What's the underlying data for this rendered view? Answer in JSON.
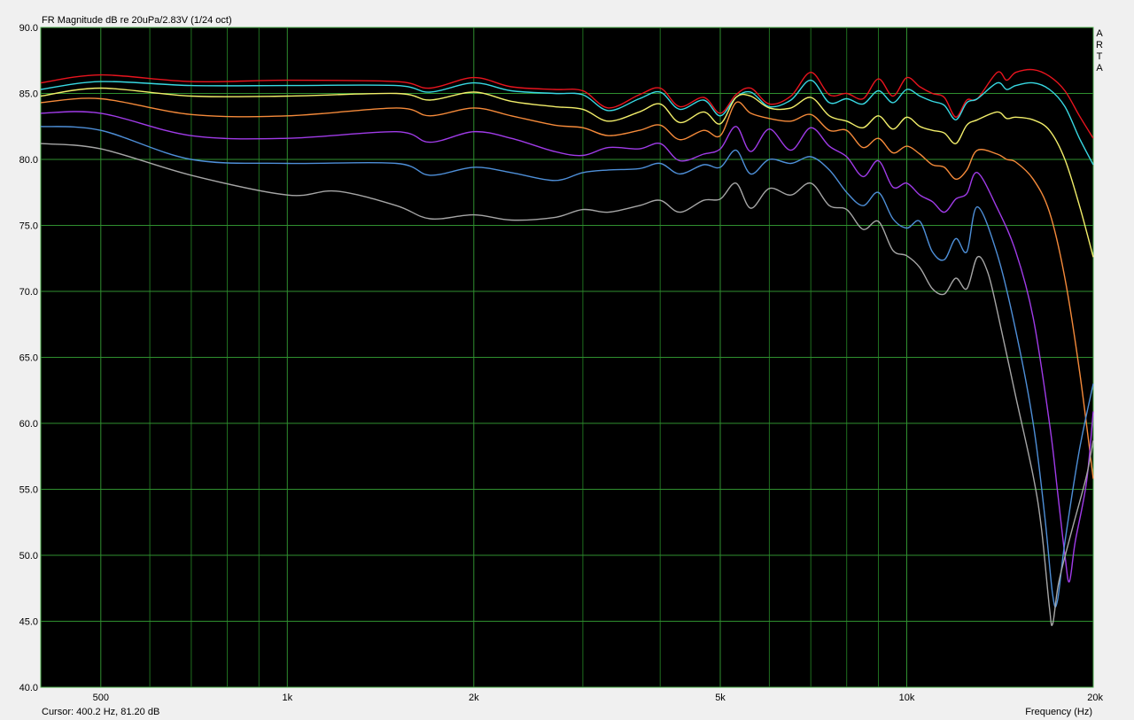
{
  "chart_data": {
    "type": "line",
    "title": "FR Magnitude dB re 20uPa/2.83V (1/24 oct)",
    "xlabel": "Frequency (Hz)",
    "ylabel": "",
    "xscale": "log",
    "xlim": [
      400,
      20000
    ],
    "ylim": [
      40,
      90
    ],
    "grid": true,
    "y_ticks": [
      "90.0",
      "85.0",
      "80.0",
      "75.0",
      "70.0",
      "65.0",
      "60.0",
      "55.0",
      "50.0",
      "45.0",
      "40.0"
    ],
    "x_ticks": [
      {
        "value": 500,
        "label": "500"
      },
      {
        "value": 1000,
        "label": "1k"
      },
      {
        "value": 2000,
        "label": "2k"
      },
      {
        "value": 5000,
        "label": "5k"
      },
      {
        "value": 10000,
        "label": "10k"
      },
      {
        "value": 20000,
        "label": "20k"
      }
    ],
    "cursor_text": "Cursor: 400.2 Hz, 81.20 dB",
    "watermark": "ARTA",
    "series": [
      {
        "color": "#e8141e",
        "points": [
          [
            400,
            85.8
          ],
          [
            500,
            86.4
          ],
          [
            700,
            85.9
          ],
          [
            1000,
            86.0
          ],
          [
            1500,
            85.9
          ],
          [
            1700,
            85.4
          ],
          [
            2000,
            86.2
          ],
          [
            2300,
            85.5
          ],
          [
            2700,
            85.3
          ],
          [
            3000,
            85.2
          ],
          [
            3300,
            83.9
          ],
          [
            3700,
            84.9
          ],
          [
            4000,
            85.4
          ],
          [
            4300,
            84.0
          ],
          [
            4700,
            84.7
          ],
          [
            5000,
            83.5
          ],
          [
            5300,
            84.9
          ],
          [
            5600,
            85.4
          ],
          [
            6000,
            84.2
          ],
          [
            6500,
            84.8
          ],
          [
            7000,
            86.6
          ],
          [
            7500,
            84.9
          ],
          [
            8000,
            85.0
          ],
          [
            8500,
            84.6
          ],
          [
            9000,
            86.1
          ],
          [
            9500,
            84.8
          ],
          [
            10000,
            86.2
          ],
          [
            10500,
            85.5
          ],
          [
            11000,
            85.0
          ],
          [
            11500,
            84.7
          ],
          [
            12000,
            83.2
          ],
          [
            12500,
            84.5
          ],
          [
            13000,
            84.6
          ],
          [
            14000,
            86.6
          ],
          [
            14500,
            86.0
          ],
          [
            15000,
            86.6
          ],
          [
            16000,
            86.8
          ],
          [
            17000,
            86.3
          ],
          [
            18000,
            85.2
          ],
          [
            19000,
            83.3
          ],
          [
            20000,
            81.6
          ]
        ]
      },
      {
        "color": "#38d8e2",
        "points": [
          [
            400,
            85.3
          ],
          [
            500,
            85.9
          ],
          [
            700,
            85.6
          ],
          [
            1000,
            85.6
          ],
          [
            1500,
            85.6
          ],
          [
            1700,
            85.1
          ],
          [
            2000,
            85.8
          ],
          [
            2300,
            85.2
          ],
          [
            2700,
            85.0
          ],
          [
            3000,
            84.9
          ],
          [
            3300,
            83.7
          ],
          [
            3700,
            84.6
          ],
          [
            4000,
            85.1
          ],
          [
            4300,
            83.8
          ],
          [
            4700,
            84.5
          ],
          [
            5000,
            83.3
          ],
          [
            5300,
            84.7
          ],
          [
            5600,
            85.1
          ],
          [
            6000,
            84.0
          ],
          [
            6500,
            84.5
          ],
          [
            7000,
            86.0
          ],
          [
            7500,
            84.3
          ],
          [
            8000,
            84.6
          ],
          [
            8500,
            84.2
          ],
          [
            9000,
            85.2
          ],
          [
            9500,
            84.3
          ],
          [
            10000,
            85.3
          ],
          [
            10500,
            84.8
          ],
          [
            11000,
            84.4
          ],
          [
            11500,
            84.1
          ],
          [
            12000,
            83.0
          ],
          [
            12500,
            84.3
          ],
          [
            13000,
            84.6
          ],
          [
            14000,
            85.8
          ],
          [
            14500,
            85.3
          ],
          [
            15000,
            85.6
          ],
          [
            16000,
            85.8
          ],
          [
            17000,
            85.3
          ],
          [
            18000,
            84.0
          ],
          [
            19000,
            81.6
          ],
          [
            20000,
            79.6
          ]
        ]
      },
      {
        "color": "#f2ee6a",
        "points": [
          [
            400,
            84.8
          ],
          [
            500,
            85.4
          ],
          [
            700,
            84.8
          ],
          [
            1000,
            84.8
          ],
          [
            1500,
            85.0
          ],
          [
            1700,
            84.5
          ],
          [
            2000,
            85.1
          ],
          [
            2300,
            84.4
          ],
          [
            2700,
            84.0
          ],
          [
            3000,
            83.8
          ],
          [
            3300,
            82.9
          ],
          [
            3700,
            83.6
          ],
          [
            4000,
            84.2
          ],
          [
            4300,
            82.8
          ],
          [
            4700,
            83.6
          ],
          [
            5000,
            82.7
          ],
          [
            5300,
            84.7
          ],
          [
            5600,
            84.8
          ],
          [
            6000,
            83.9
          ],
          [
            6500,
            83.9
          ],
          [
            7000,
            84.7
          ],
          [
            7500,
            83.3
          ],
          [
            8000,
            82.9
          ],
          [
            8500,
            82.4
          ],
          [
            9000,
            83.3
          ],
          [
            9500,
            82.3
          ],
          [
            10000,
            83.2
          ],
          [
            10500,
            82.5
          ],
          [
            11000,
            82.2
          ],
          [
            11500,
            82.0
          ],
          [
            12000,
            81.2
          ],
          [
            12500,
            82.6
          ],
          [
            13000,
            83.0
          ],
          [
            14000,
            83.6
          ],
          [
            14500,
            83.1
          ],
          [
            15000,
            83.2
          ],
          [
            16000,
            83.0
          ],
          [
            17000,
            82.2
          ],
          [
            18000,
            80.0
          ],
          [
            19000,
            76.5
          ],
          [
            20000,
            72.6
          ]
        ]
      },
      {
        "color": "#f58a3a",
        "points": [
          [
            400,
            84.3
          ],
          [
            500,
            84.6
          ],
          [
            700,
            83.4
          ],
          [
            1000,
            83.3
          ],
          [
            1500,
            83.9
          ],
          [
            1700,
            83.3
          ],
          [
            2000,
            83.9
          ],
          [
            2300,
            83.3
          ],
          [
            2700,
            82.6
          ],
          [
            3000,
            82.4
          ],
          [
            3300,
            81.8
          ],
          [
            3700,
            82.2
          ],
          [
            4000,
            82.6
          ],
          [
            4300,
            81.5
          ],
          [
            4700,
            82.2
          ],
          [
            5000,
            81.8
          ],
          [
            5300,
            84.3
          ],
          [
            5600,
            83.5
          ],
          [
            6000,
            83.1
          ],
          [
            6500,
            82.9
          ],
          [
            7000,
            83.4
          ],
          [
            7500,
            82.2
          ],
          [
            8000,
            82.2
          ],
          [
            8500,
            80.9
          ],
          [
            9000,
            81.6
          ],
          [
            9500,
            80.5
          ],
          [
            10000,
            81.0
          ],
          [
            10500,
            80.4
          ],
          [
            11000,
            79.6
          ],
          [
            11500,
            79.4
          ],
          [
            12000,
            78.5
          ],
          [
            12500,
            79.2
          ],
          [
            13000,
            80.7
          ],
          [
            14000,
            80.4
          ],
          [
            14500,
            80.0
          ],
          [
            15000,
            79.8
          ],
          [
            16000,
            78.5
          ],
          [
            17000,
            76.0
          ],
          [
            18000,
            71.0
          ],
          [
            19000,
            64.0
          ],
          [
            20000,
            55.8
          ]
        ]
      },
      {
        "color": "#a03be8",
        "points": [
          [
            400,
            83.5
          ],
          [
            500,
            83.5
          ],
          [
            700,
            81.8
          ],
          [
            1000,
            81.6
          ],
          [
            1500,
            82.1
          ],
          [
            1700,
            81.3
          ],
          [
            2000,
            82.1
          ],
          [
            2300,
            81.6
          ],
          [
            2700,
            80.6
          ],
          [
            3000,
            80.3
          ],
          [
            3300,
            80.9
          ],
          [
            3700,
            80.8
          ],
          [
            4000,
            81.2
          ],
          [
            4300,
            79.9
          ],
          [
            4700,
            80.4
          ],
          [
            5000,
            80.8
          ],
          [
            5300,
            82.5
          ],
          [
            5600,
            80.6
          ],
          [
            6000,
            82.3
          ],
          [
            6500,
            80.7
          ],
          [
            7000,
            82.4
          ],
          [
            7500,
            81.0
          ],
          [
            8000,
            80.2
          ],
          [
            8500,
            78.7
          ],
          [
            9000,
            79.9
          ],
          [
            9500,
            77.9
          ],
          [
            10000,
            78.2
          ],
          [
            10500,
            77.3
          ],
          [
            11000,
            76.8
          ],
          [
            11500,
            76.0
          ],
          [
            12000,
            77.0
          ],
          [
            12500,
            77.4
          ],
          [
            13000,
            79.0
          ],
          [
            14000,
            76.3
          ],
          [
            15000,
            73.0
          ],
          [
            16000,
            68.0
          ],
          [
            17000,
            60.0
          ],
          [
            17500,
            55.0
          ],
          [
            18000,
            50.0
          ],
          [
            18300,
            48.0
          ],
          [
            18700,
            51.0
          ],
          [
            19500,
            55.5
          ],
          [
            20000,
            60.9
          ]
        ]
      },
      {
        "color": "#4e8fd8",
        "points": [
          [
            400,
            82.5
          ],
          [
            500,
            82.2
          ],
          [
            700,
            80.0
          ],
          [
            1000,
            79.7
          ],
          [
            1500,
            79.7
          ],
          [
            1700,
            78.8
          ],
          [
            2000,
            79.4
          ],
          [
            2300,
            79.0
          ],
          [
            2700,
            78.4
          ],
          [
            3000,
            79.0
          ],
          [
            3300,
            79.2
          ],
          [
            3700,
            79.3
          ],
          [
            4000,
            79.7
          ],
          [
            4300,
            78.9
          ],
          [
            4700,
            79.6
          ],
          [
            5000,
            79.4
          ],
          [
            5300,
            80.7
          ],
          [
            5600,
            78.9
          ],
          [
            6000,
            80.0
          ],
          [
            6500,
            79.7
          ],
          [
            7000,
            80.2
          ],
          [
            7500,
            79.2
          ],
          [
            8000,
            77.5
          ],
          [
            8500,
            76.5
          ],
          [
            9000,
            77.5
          ],
          [
            9500,
            75.5
          ],
          [
            10000,
            74.8
          ],
          [
            10500,
            75.3
          ],
          [
            11000,
            73.0
          ],
          [
            11500,
            72.4
          ],
          [
            12000,
            74.0
          ],
          [
            12500,
            73.0
          ],
          [
            13000,
            76.4
          ],
          [
            14000,
            72.8
          ],
          [
            15000,
            67.0
          ],
          [
            16000,
            60.0
          ],
          [
            16700,
            53.0
          ],
          [
            17200,
            47.0
          ],
          [
            17500,
            46.5
          ],
          [
            18000,
            51.0
          ],
          [
            19000,
            58.0
          ],
          [
            20000,
            63.0
          ]
        ]
      },
      {
        "color": "#a6a6a6",
        "points": [
          [
            400,
            81.2
          ],
          [
            500,
            80.8
          ],
          [
            700,
            78.8
          ],
          [
            1000,
            77.3
          ],
          [
            1200,
            77.6
          ],
          [
            1500,
            76.5
          ],
          [
            1700,
            75.5
          ],
          [
            2000,
            75.8
          ],
          [
            2300,
            75.4
          ],
          [
            2700,
            75.6
          ],
          [
            3000,
            76.2
          ],
          [
            3300,
            76.0
          ],
          [
            3700,
            76.5
          ],
          [
            4000,
            76.9
          ],
          [
            4300,
            76.0
          ],
          [
            4700,
            76.9
          ],
          [
            5000,
            77.0
          ],
          [
            5300,
            78.2
          ],
          [
            5600,
            76.3
          ],
          [
            6000,
            77.8
          ],
          [
            6500,
            77.3
          ],
          [
            7000,
            78.2
          ],
          [
            7500,
            76.5
          ],
          [
            8000,
            76.2
          ],
          [
            8500,
            74.7
          ],
          [
            9000,
            75.3
          ],
          [
            9500,
            73.1
          ],
          [
            10000,
            72.7
          ],
          [
            10500,
            71.8
          ],
          [
            11000,
            70.2
          ],
          [
            11500,
            69.8
          ],
          [
            12000,
            71.0
          ],
          [
            12500,
            70.2
          ],
          [
            13000,
            72.6
          ],
          [
            13500,
            71.5
          ],
          [
            14000,
            68.5
          ],
          [
            15000,
            62.0
          ],
          [
            16000,
            56.0
          ],
          [
            16500,
            52.0
          ],
          [
            17000,
            46.0
          ],
          [
            17200,
            44.8
          ],
          [
            17600,
            48.0
          ],
          [
            18500,
            52.0
          ],
          [
            19500,
            56.0
          ],
          [
            20000,
            58.7
          ]
        ]
      }
    ]
  }
}
